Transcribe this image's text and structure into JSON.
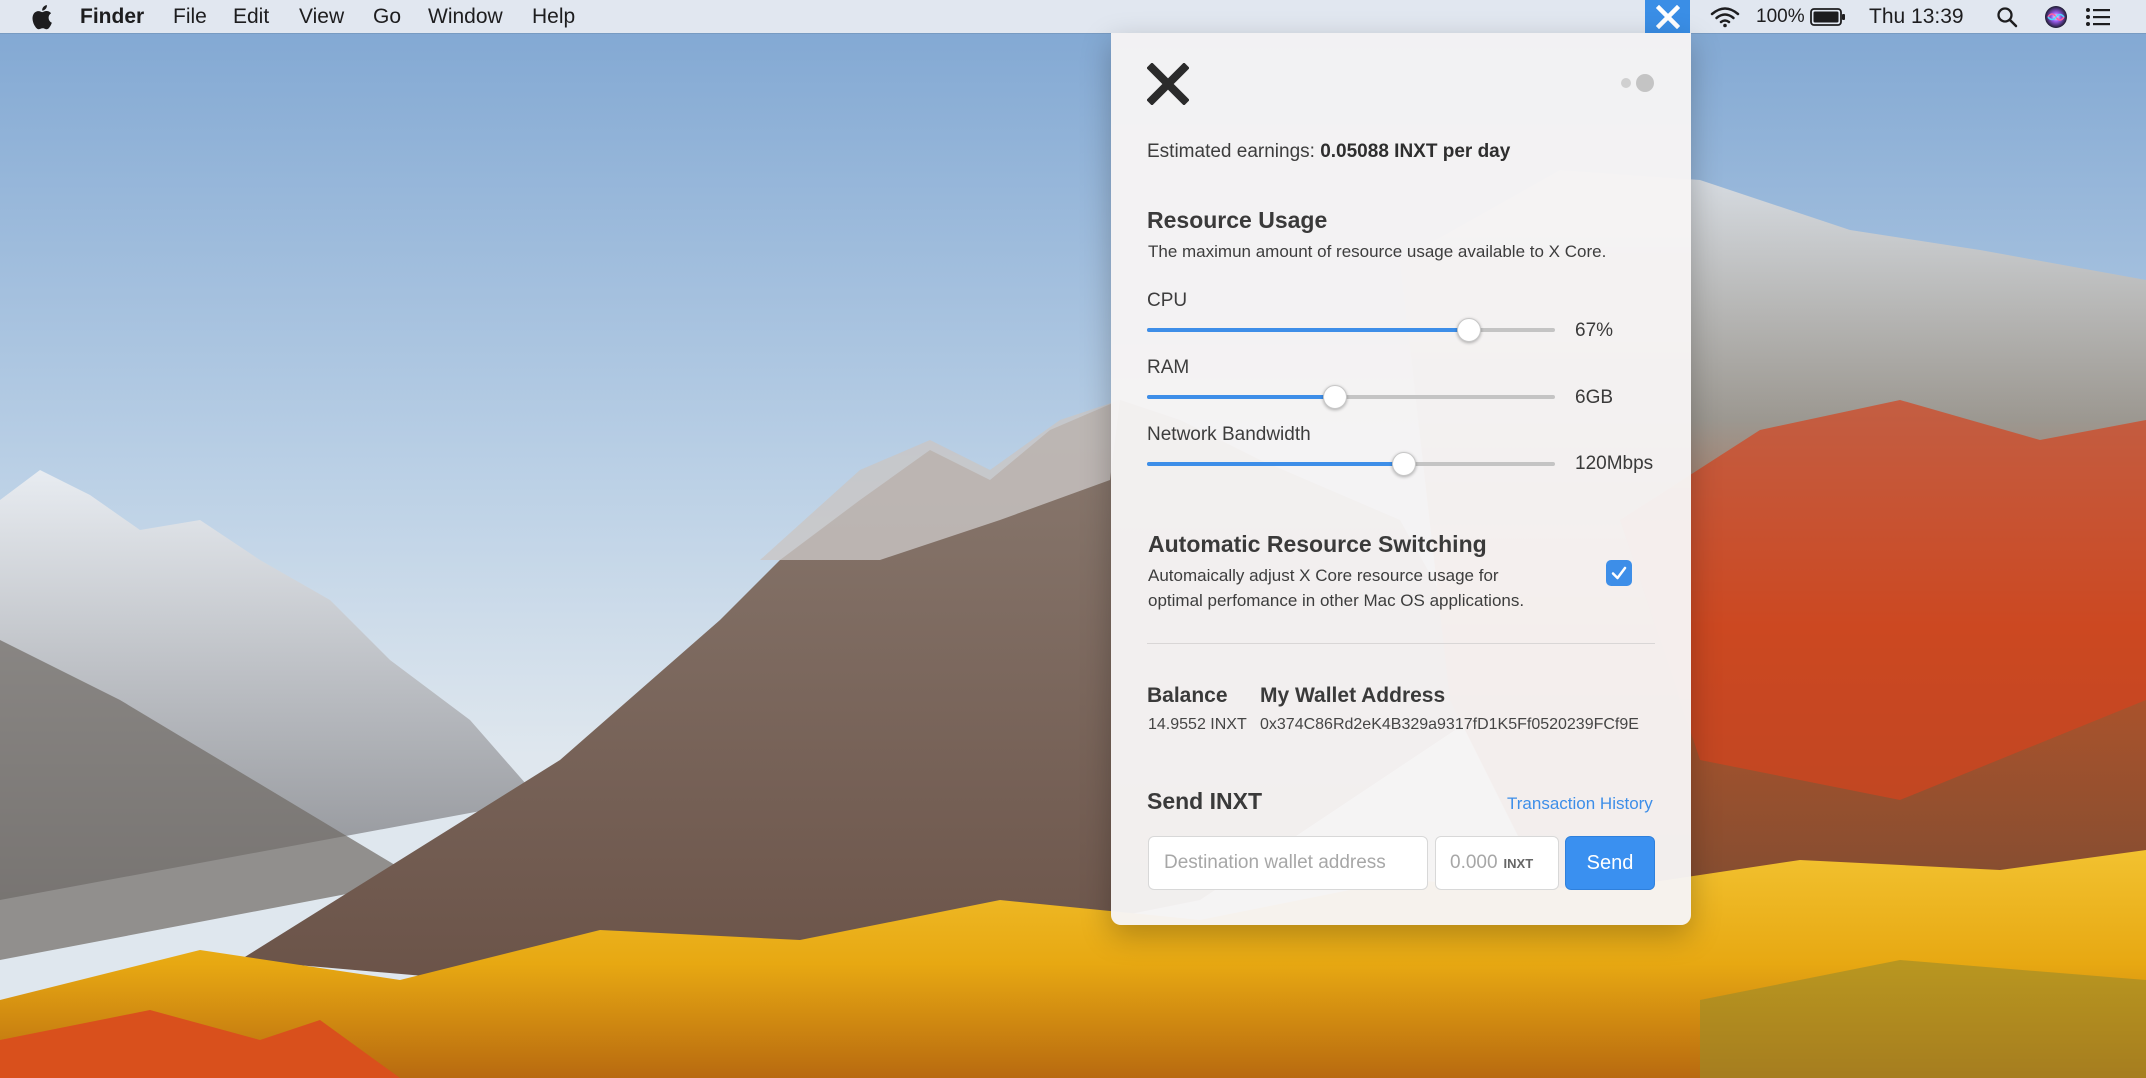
{
  "menubar": {
    "app_name": "Finder",
    "menus": [
      "File",
      "Edit",
      "View",
      "Go",
      "Window",
      "Help"
    ],
    "battery_percent": "100%",
    "clock": "Thu 13:39",
    "icons": [
      "apple-icon",
      "x-core-icon",
      "wifi-icon",
      "battery-icon",
      "search-icon",
      "siri-icon",
      "notification-center-icon"
    ]
  },
  "panel": {
    "earnings_label": "Estimated earnings:",
    "earnings_value": "0.05088 INXT per day",
    "resource_title": "Resource Usage",
    "resource_desc": "The maximun amount of resource usage available to X Core.",
    "sliders": [
      {
        "label": "CPU",
        "value": "67%",
        "level": 0.79
      },
      {
        "label": "RAM",
        "value": "6GB",
        "level": 0.46
      },
      {
        "label": "Network Bandwidth",
        "value": "120Mbps",
        "level": 0.63
      }
    ],
    "auto_title": "Automatic Resource Switching",
    "auto_desc_line1": "Automaically adjust X Core resource usage for",
    "auto_desc_line2": "optimal perfomance in other Mac OS applications.",
    "auto_checked": true,
    "balance_label": "Balance",
    "balance_value": "14.9552 INXT",
    "wallet_label": "My Wallet Address",
    "wallet_value": "0x374C86Rd2eK4B329a9317fD1K5Ff0520239FCf9E",
    "send_title": "Send INXT",
    "history_link": "Transaction History",
    "dest_placeholder": "Destination wallet address",
    "amount_placeholder": "0.000",
    "amount_unit": "INXT",
    "send_label": "Send"
  },
  "colors": {
    "accent": "#3d8ee8",
    "menubar_highlight": "#3a8ee6"
  }
}
